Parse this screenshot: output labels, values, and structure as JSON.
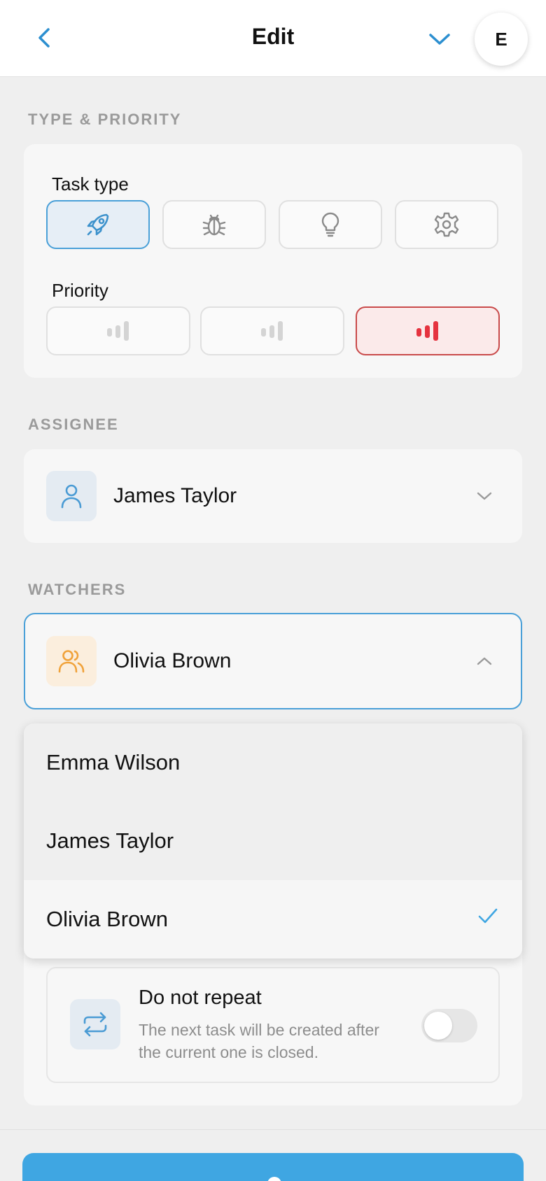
{
  "header": {
    "title": "Edit",
    "avatar_initial": "E",
    "back_icon": "chevron-left-icon",
    "collapse_icon": "chevron-down-icon"
  },
  "type_priority": {
    "section_label": "TYPE & PRIORITY",
    "task_type_label": "Task type",
    "task_types": [
      {
        "icon": "rocket-icon",
        "selected": true
      },
      {
        "icon": "bug-icon",
        "selected": false
      },
      {
        "icon": "lightbulb-icon",
        "selected": false
      },
      {
        "icon": "gear-icon",
        "selected": false
      }
    ],
    "priority_label": "Priority",
    "priorities": [
      {
        "icon": "signal-low-icon",
        "selected": false
      },
      {
        "icon": "signal-medium-icon",
        "selected": false
      },
      {
        "icon": "signal-high-icon",
        "selected": true
      }
    ]
  },
  "assignee": {
    "section_label": "ASSIGNEE",
    "value": "James Taylor",
    "icon": "user-icon"
  },
  "watchers": {
    "section_label": "WATCHERS",
    "value": "Olivia Brown",
    "icon": "users-icon",
    "options": [
      "Emma Wilson",
      "James Taylor",
      "Olivia Brown"
    ],
    "selected_option": "Olivia Brown"
  },
  "repeat": {
    "title": "Do not repeat",
    "description": "The next task will be created after the current one is closed.",
    "icon": "repeat-icon",
    "enabled": false
  },
  "colors": {
    "accent": "#3fa6e2",
    "priority_high": "#e5333f",
    "watchers_icon": "#f0a23a"
  }
}
